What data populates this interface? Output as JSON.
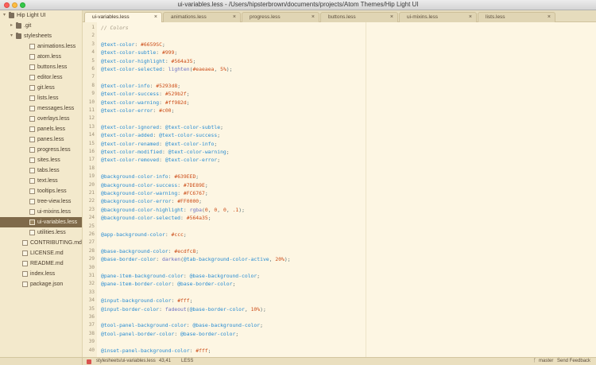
{
  "window": {
    "title": "ui-variables.less - /Users/hipsterbrown/documents/projects/Atom Themes/Hip Light UI"
  },
  "sidebar": {
    "items": [
      {
        "label": "Hip Light UI",
        "kind": "folder",
        "expanded": true,
        "depth": 0
      },
      {
        "label": ".git",
        "kind": "folder",
        "expanded": false,
        "depth": 1
      },
      {
        "label": "stylesheets",
        "kind": "folder",
        "expanded": true,
        "depth": 1
      },
      {
        "label": "animations.less",
        "kind": "file",
        "depth": 2
      },
      {
        "label": "atom.less",
        "kind": "file",
        "depth": 2
      },
      {
        "label": "buttons.less",
        "kind": "file",
        "depth": 2
      },
      {
        "label": "editor.less",
        "kind": "file",
        "depth": 2
      },
      {
        "label": "git.less",
        "kind": "file",
        "depth": 2
      },
      {
        "label": "lists.less",
        "kind": "file",
        "depth": 2
      },
      {
        "label": "messages.less",
        "kind": "file",
        "depth": 2
      },
      {
        "label": "overlays.less",
        "kind": "file",
        "depth": 2
      },
      {
        "label": "panels.less",
        "kind": "file",
        "depth": 2
      },
      {
        "label": "panes.less",
        "kind": "file",
        "depth": 2
      },
      {
        "label": "progress.less",
        "kind": "file",
        "depth": 2
      },
      {
        "label": "sites.less",
        "kind": "file",
        "depth": 2
      },
      {
        "label": "tabs.less",
        "kind": "file",
        "depth": 2
      },
      {
        "label": "text.less",
        "kind": "file",
        "depth": 2
      },
      {
        "label": "tooltips.less",
        "kind": "file",
        "depth": 2
      },
      {
        "label": "tree-view.less",
        "kind": "file",
        "depth": 2
      },
      {
        "label": "ui-mixins.less",
        "kind": "file",
        "depth": 2
      },
      {
        "label": "ui-variables.less",
        "kind": "file",
        "depth": 2,
        "selected": true
      },
      {
        "label": "utilities.less",
        "kind": "file",
        "depth": 2
      },
      {
        "label": "CONTRIBUTING.md",
        "kind": "file",
        "depth": 1
      },
      {
        "label": "LICENSE.md",
        "kind": "file",
        "depth": 1
      },
      {
        "label": "README.md",
        "kind": "file",
        "depth": 1
      },
      {
        "label": "index.less",
        "kind": "file",
        "depth": 1
      },
      {
        "label": "package.json",
        "kind": "file",
        "depth": 1
      }
    ]
  },
  "tabs": [
    {
      "label": "ui-variables.less",
      "active": true
    },
    {
      "label": "animations.less",
      "active": false
    },
    {
      "label": "progress.less",
      "active": false
    },
    {
      "label": "buttons.less",
      "active": false
    },
    {
      "label": "ui-mixins.less",
      "active": false
    },
    {
      "label": "lists.less",
      "active": false
    }
  ],
  "tab_close_glyph": "×",
  "editor": {
    "lines": [
      [
        [
          "comment",
          "// Colors"
        ]
      ],
      [],
      [
        [
          "var",
          "@text-color"
        ],
        [
          "text",
          ": "
        ],
        [
          "val",
          "#6659SC"
        ],
        [
          "text",
          ";"
        ]
      ],
      [
        [
          "var",
          "@text-color-subtle"
        ],
        [
          "text",
          ": "
        ],
        [
          "val",
          "#999"
        ],
        [
          "text",
          ";"
        ]
      ],
      [
        [
          "var",
          "@text-color-highlight"
        ],
        [
          "text",
          ": "
        ],
        [
          "val",
          "#564a35"
        ],
        [
          "text",
          ";"
        ]
      ],
      [
        [
          "var",
          "@text-color-selected"
        ],
        [
          "text",
          ": "
        ],
        [
          "fn",
          "lighten"
        ],
        [
          "text",
          "("
        ],
        [
          "val",
          "#eaeaea"
        ],
        [
          "text",
          ", "
        ],
        [
          "val",
          "5%"
        ],
        [
          "text",
          ");"
        ]
      ],
      [],
      [
        [
          "var",
          "@text-color-info"
        ],
        [
          "text",
          ": "
        ],
        [
          "val",
          "#5293d8"
        ],
        [
          "text",
          ";"
        ]
      ],
      [
        [
          "var",
          "@text-color-success"
        ],
        [
          "text",
          ": "
        ],
        [
          "val",
          "#529b2f"
        ],
        [
          "text",
          ";"
        ]
      ],
      [
        [
          "var",
          "@text-color-warning"
        ],
        [
          "text",
          ": "
        ],
        [
          "val",
          "#ff982d"
        ],
        [
          "text",
          ";"
        ]
      ],
      [
        [
          "var",
          "@text-color-error"
        ],
        [
          "text",
          ": "
        ],
        [
          "val",
          "#c00"
        ],
        [
          "text",
          ";"
        ]
      ],
      [],
      [
        [
          "var",
          "@text-color-ignored"
        ],
        [
          "text",
          ": "
        ],
        [
          "var",
          "@text-color-subtle"
        ],
        [
          "text",
          ";"
        ]
      ],
      [
        [
          "var",
          "@text-color-added"
        ],
        [
          "text",
          ": "
        ],
        [
          "var",
          "@text-color-success"
        ],
        [
          "text",
          ";"
        ]
      ],
      [
        [
          "var",
          "@text-color-renamed"
        ],
        [
          "text",
          ": "
        ],
        [
          "var",
          "@text-color-info"
        ],
        [
          "text",
          ";"
        ]
      ],
      [
        [
          "var",
          "@text-color-modified"
        ],
        [
          "text",
          ": "
        ],
        [
          "var",
          "@text-color-warning"
        ],
        [
          "text",
          ";"
        ]
      ],
      [
        [
          "var",
          "@text-color-removed"
        ],
        [
          "text",
          ": "
        ],
        [
          "var",
          "@text-color-error"
        ],
        [
          "text",
          ";"
        ]
      ],
      [],
      [
        [
          "var",
          "@background-color-info"
        ],
        [
          "text",
          ": "
        ],
        [
          "val",
          "#639EED"
        ],
        [
          "text",
          ";"
        ]
      ],
      [
        [
          "var",
          "@background-color-success"
        ],
        [
          "text",
          ": "
        ],
        [
          "val",
          "#7DE89E"
        ],
        [
          "text",
          ";"
        ]
      ],
      [
        [
          "var",
          "@background-color-warning"
        ],
        [
          "text",
          ": "
        ],
        [
          "val",
          "#FC6767"
        ],
        [
          "text",
          ";"
        ]
      ],
      [
        [
          "var",
          "@background-color-error"
        ],
        [
          "text",
          ": "
        ],
        [
          "val",
          "#FF0000"
        ],
        [
          "text",
          ";"
        ]
      ],
      [
        [
          "var",
          "@background-color-highlight"
        ],
        [
          "text",
          ": "
        ],
        [
          "fn",
          "rgba"
        ],
        [
          "text",
          "("
        ],
        [
          "val",
          "0"
        ],
        [
          "text",
          ", "
        ],
        [
          "val",
          "0"
        ],
        [
          "text",
          ", "
        ],
        [
          "val",
          "0"
        ],
        [
          "text",
          ", "
        ],
        [
          "val",
          ".1"
        ],
        [
          "text",
          ");"
        ]
      ],
      [
        [
          "var",
          "@background-color-selected"
        ],
        [
          "text",
          ": "
        ],
        [
          "val",
          "#564a35"
        ],
        [
          "text",
          ";"
        ]
      ],
      [],
      [
        [
          "var",
          "@app-background-color"
        ],
        [
          "text",
          ": "
        ],
        [
          "val",
          "#ccc"
        ],
        [
          "text",
          ";"
        ]
      ],
      [],
      [
        [
          "var",
          "@base-background-color"
        ],
        [
          "text",
          ": "
        ],
        [
          "val",
          "#ecdfc8"
        ],
        [
          "text",
          ";"
        ]
      ],
      [
        [
          "var",
          "@base-border-color"
        ],
        [
          "text",
          ": "
        ],
        [
          "fn",
          "darken"
        ],
        [
          "text",
          "("
        ],
        [
          "var",
          "@tab-background-color-active"
        ],
        [
          "text",
          ", "
        ],
        [
          "val",
          "20%"
        ],
        [
          "text",
          ");"
        ]
      ],
      [],
      [
        [
          "var",
          "@pane-item-background-color"
        ],
        [
          "text",
          ": "
        ],
        [
          "var",
          "@base-background-color"
        ],
        [
          "text",
          ";"
        ]
      ],
      [
        [
          "var",
          "@pane-item-border-color"
        ],
        [
          "text",
          ": "
        ],
        [
          "var",
          "@base-border-color"
        ],
        [
          "text",
          ";"
        ]
      ],
      [],
      [
        [
          "var",
          "@input-background-color"
        ],
        [
          "text",
          ": "
        ],
        [
          "val",
          "#fff"
        ],
        [
          "text",
          ";"
        ]
      ],
      [
        [
          "var",
          "@input-border-color"
        ],
        [
          "text",
          ": "
        ],
        [
          "fn",
          "fadeout"
        ],
        [
          "text",
          "("
        ],
        [
          "var",
          "@base-border-color"
        ],
        [
          "text",
          ", "
        ],
        [
          "val",
          "10%"
        ],
        [
          "text",
          ");"
        ]
      ],
      [],
      [
        [
          "var",
          "@tool-panel-background-color"
        ],
        [
          "text",
          ": "
        ],
        [
          "var",
          "@base-background-color"
        ],
        [
          "text",
          ";"
        ]
      ],
      [
        [
          "var",
          "@tool-panel-border-color"
        ],
        [
          "text",
          ": "
        ],
        [
          "var",
          "@base-border-color"
        ],
        [
          "text",
          ";"
        ]
      ],
      [],
      [
        [
          "var",
          "@inset-panel-background-color"
        ],
        [
          "text",
          ": "
        ],
        [
          "val",
          "#fff"
        ],
        [
          "text",
          ";"
        ]
      ]
    ]
  },
  "statusbar": {
    "path": "stylesheets/ui-variables.less",
    "cursor": "43,41",
    "grammar": "LESS",
    "branch_icon": "ᚴ",
    "branch": "master",
    "feedback": "Send Feedback"
  },
  "colors": {
    "sidebar_bg": "#f3e9cc",
    "selected_row": "#7f6a4a",
    "editor_bg": "#fdf6e3",
    "variable": "#268bd2",
    "value": "#cb4b16"
  }
}
